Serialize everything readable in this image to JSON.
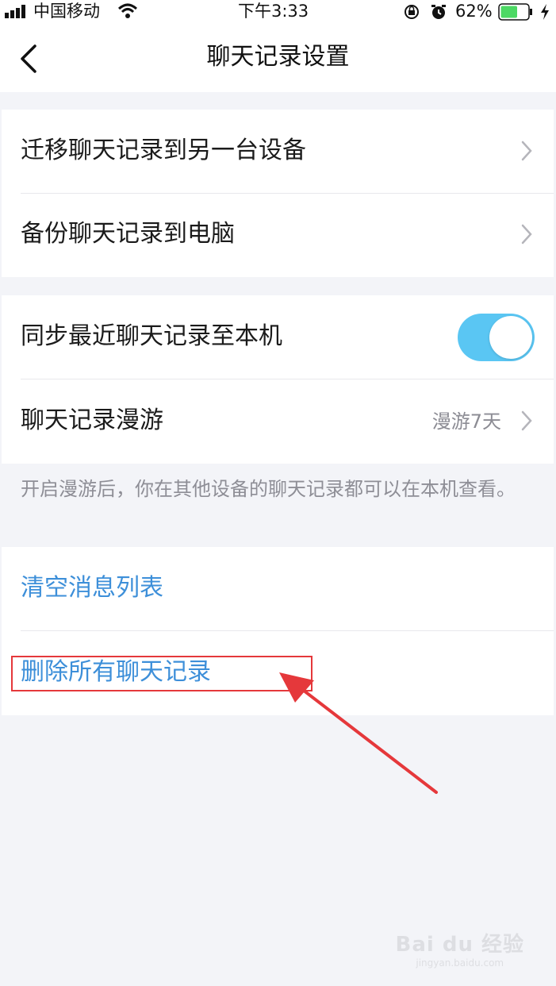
{
  "status_bar": {
    "carrier": "中国移动",
    "time": "下午3:33",
    "battery": "62%",
    "battery_level": 0.62,
    "icons": [
      "signal-icon",
      "wifi-icon",
      "orientation-lock-icon",
      "alarm-icon",
      "battery-icon",
      "charging-icon"
    ]
  },
  "nav": {
    "title": "聊天记录设置",
    "back_icon": "chevron-left-icon"
  },
  "sections": {
    "migrate": {
      "label": "迁移聊天记录到另一台设备"
    },
    "backup": {
      "label": "备份聊天记录到电脑"
    },
    "sync": {
      "label": "同步最近聊天记录至本机",
      "enabled": true
    },
    "roaming": {
      "label": "聊天记录漫游",
      "value": "漫游7天"
    },
    "hint": "开启漫游后，你在其他设备的聊天记录都可以在本机查看。",
    "clear_list": {
      "label": "清空消息列表"
    },
    "delete_all": {
      "label": "删除所有聊天记录"
    }
  },
  "colors": {
    "accent": "#3d8fd9",
    "toggle_on": "#5ac6f3",
    "annotation": "#e5383b",
    "background": "#f3f4f8"
  },
  "watermark": {
    "logo": "Bai du 经验",
    "sub": "jingyan.baidu.com"
  }
}
